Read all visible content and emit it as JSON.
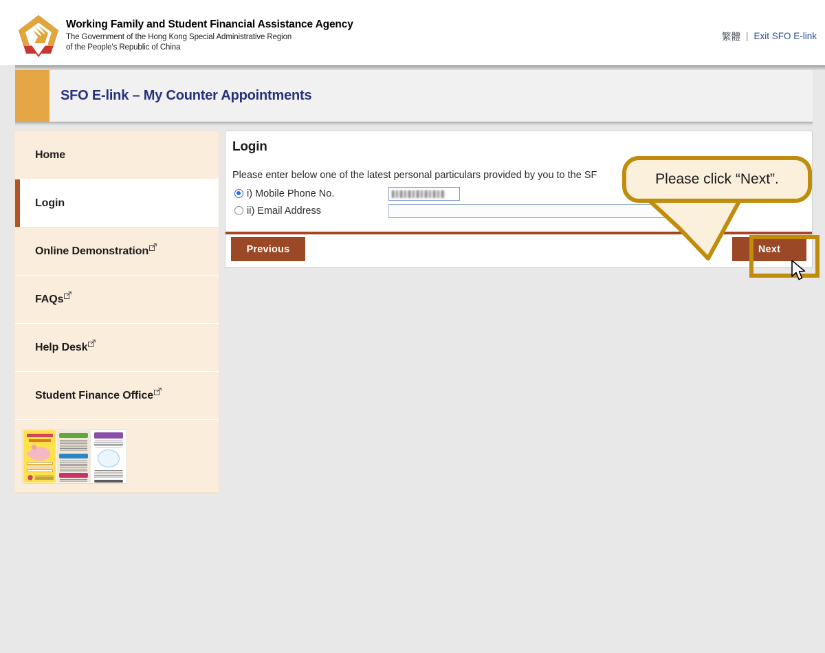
{
  "header": {
    "org_title": "Working Family and Student Financial Assistance Agency",
    "org_sub_line1": "The Government of the Hong Kong Special Administrative Region",
    "org_sub_line2": "of the People's Republic of China",
    "logo_icon": "wfsfaa-pentagon-logo",
    "lang_link": "繁體",
    "separator": "|",
    "exit_link": "Exit SFO E-link"
  },
  "title_bar": {
    "title": "SFO E-link – My Counter Appointments",
    "accent_color": "#e5a745"
  },
  "sidebar": {
    "items": [
      {
        "label": "Home",
        "external": false,
        "active": false
      },
      {
        "label": "Login",
        "external": false,
        "active": true
      },
      {
        "label": "Online Demonstration",
        "external": true,
        "active": false
      },
      {
        "label": "FAQs",
        "external": true,
        "active": false
      },
      {
        "label": "Help Desk",
        "external": true,
        "active": false
      },
      {
        "label": "Student Finance Office",
        "external": true,
        "active": false
      }
    ],
    "banner_alt": "student-financial-management-leaflet",
    "external_icon": "external-link-icon",
    "bg_color": "#faeddc",
    "active_bar_color": "#b05523"
  },
  "login": {
    "heading": "Login",
    "intro": "Please enter below one of the latest personal particulars provided by you to the SF",
    "options": [
      {
        "label": "i) Mobile Phone No.",
        "selected": true,
        "value": "",
        "placeholder": "",
        "redacted": true
      },
      {
        "label": "ii) Email Address",
        "selected": false,
        "value": "",
        "placeholder": "",
        "redacted": false
      }
    ],
    "buttons": {
      "previous": "Previous",
      "next": "Next"
    },
    "divider_color": "#a8471f",
    "button_color": "#9a4826"
  },
  "annotation": {
    "callout_text": "Please click “Next”.",
    "highlight_color": "#c08c0b",
    "cursor_icon": "mouse-pointer-icon"
  }
}
